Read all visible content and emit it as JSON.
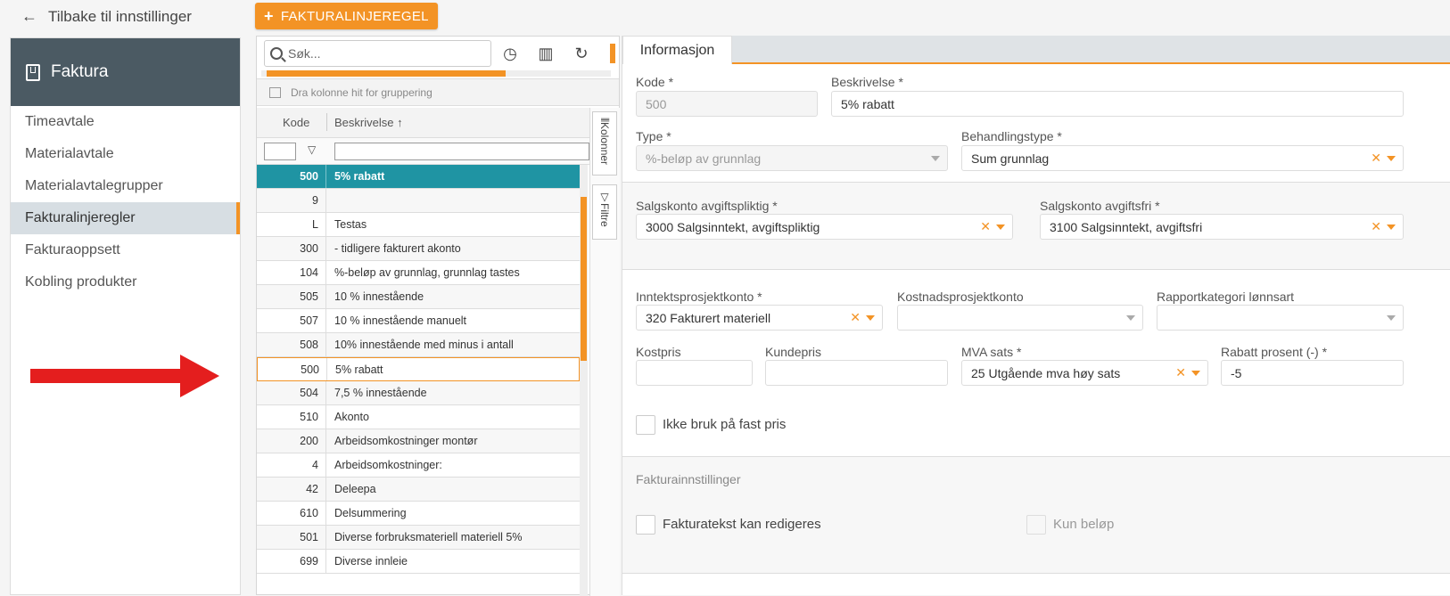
{
  "topbar": {
    "back_label": "Tilbake til innstillinger",
    "add_button": "FAKTURALINJEREGEL"
  },
  "sidebar": {
    "title": "Faktura",
    "items": [
      {
        "label": "Timeavtale"
      },
      {
        "label": "Materialavtale"
      },
      {
        "label": "Materialavtalegrupper"
      },
      {
        "label": "Fakturalinjeregler"
      },
      {
        "label": "Fakturaoppsett"
      },
      {
        "label": "Kobling produkter"
      }
    ],
    "active_index": 3
  },
  "grid": {
    "search_placeholder": "Søk...",
    "group_hint": "Dra kolonne hit for gruppering",
    "col_code": "Kode",
    "col_desc": "Beskrivelse ↑",
    "side_tab_columns": "Kolonner",
    "side_tab_filters": "Filtre",
    "rows": [
      {
        "code": "500",
        "desc": "5% rabatt"
      },
      {
        "code": "9",
        "desc": ""
      },
      {
        "code": "L",
        "desc": "Testas"
      },
      {
        "code": "300",
        "desc": "- tidligere fakturert akonto"
      },
      {
        "code": "104",
        "desc": "%-beløp av grunnlag, grunnlag tastes"
      },
      {
        "code": "505",
        "desc": "10 % innestående"
      },
      {
        "code": "507",
        "desc": "10 % innestående manuelt"
      },
      {
        "code": "508",
        "desc": "10% innestående med minus i antall"
      },
      {
        "code": "500",
        "desc": "5% rabatt"
      },
      {
        "code": "504",
        "desc": "7,5 % innestående"
      },
      {
        "code": "510",
        "desc": "Akonto"
      },
      {
        "code": "200",
        "desc": "Arbeidsomkostninger montør"
      },
      {
        "code": "4",
        "desc": "Arbeidsomkostninger:"
      },
      {
        "code": "42",
        "desc": "Deleepa"
      },
      {
        "code": "610",
        "desc": "Delsummering"
      },
      {
        "code": "501",
        "desc": "Diverse forbruksmateriell materiell 5%"
      },
      {
        "code": "699",
        "desc": "Diverse innleie"
      }
    ]
  },
  "form": {
    "tab": "Informasjon",
    "kode_label": "Kode *",
    "kode_value": "500",
    "beskrivelse_label": "Beskrivelse *",
    "beskrivelse_value": "5% rabatt",
    "type_label": "Type *",
    "type_value": "%-beløp av grunnlag",
    "behandling_label": "Behandlingstype *",
    "behandling_value": "Sum grunnlag",
    "salg_pliktig_label": "Salgskonto avgiftspliktig *",
    "salg_pliktig_value": "3000 Salgsinntekt, avgiftspliktig",
    "salg_fri_label": "Salgskonto avgiftsfri *",
    "salg_fri_value": "3100 Salgsinntekt, avgiftsfri",
    "inntekt_label": "Inntektsprosjektkonto *",
    "inntekt_value": "320 Fakturert materiell",
    "kostnad_label": "Kostnadsprosjektkonto",
    "rapport_label": "Rapportkategori lønnsart",
    "kostpris_label": "Kostpris",
    "kundepris_label": "Kundepris",
    "mva_label": "MVA sats *",
    "mva_value": "25 Utgående mva høy sats",
    "rabatt_label": "Rabatt prosent (-) *",
    "rabatt_value": "-5",
    "fast_pris_label": "Ikke bruk på fast pris",
    "section_faktura": "Fakturainnstillinger",
    "redigeres_label": "Fakturatekst kan redigeres",
    "kun_belop_label": "Kun beløp"
  }
}
